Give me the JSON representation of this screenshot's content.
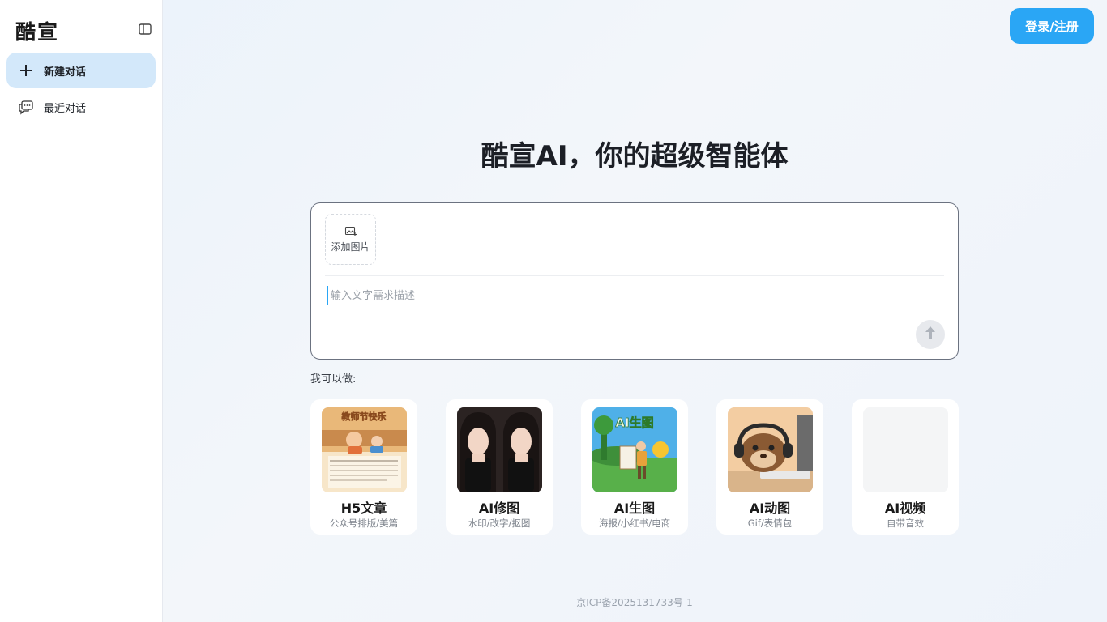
{
  "app": {
    "brand": "酷宣"
  },
  "sidebar": {
    "items": [
      {
        "label": "新建对话",
        "icon": "plus-icon",
        "active": true
      },
      {
        "label": "最近对话",
        "icon": "chat-bubbles-icon",
        "active": false
      }
    ]
  },
  "header": {
    "login_label": "登录/注册"
  },
  "hero": {
    "title": "酷宣AI，你的超级智能体"
  },
  "composer": {
    "add_image_label": "添加图片",
    "placeholder": "输入文字需求描述",
    "value": ""
  },
  "capabilities": {
    "heading": "我可以做:",
    "cards": [
      {
        "title": "H5文章",
        "subtitle": "公众号排版/美篇",
        "thumb_text": "教师节快乐"
      },
      {
        "title": "AI修图",
        "subtitle": "水印/改字/抠图"
      },
      {
        "title": "AI生图",
        "subtitle": "海报/小红书/电商",
        "thumb_text": "AI生图"
      },
      {
        "title": "AI动图",
        "subtitle": "Gif/表情包"
      },
      {
        "title": "AI视频",
        "subtitle": "自带音效"
      }
    ]
  },
  "footer": {
    "icp": "京ICP备2025131733号-1"
  },
  "colors": {
    "accent": "#2aa6f5",
    "active_nav_bg": "#d3e8fa",
    "page_bg": "#eef3fa"
  }
}
